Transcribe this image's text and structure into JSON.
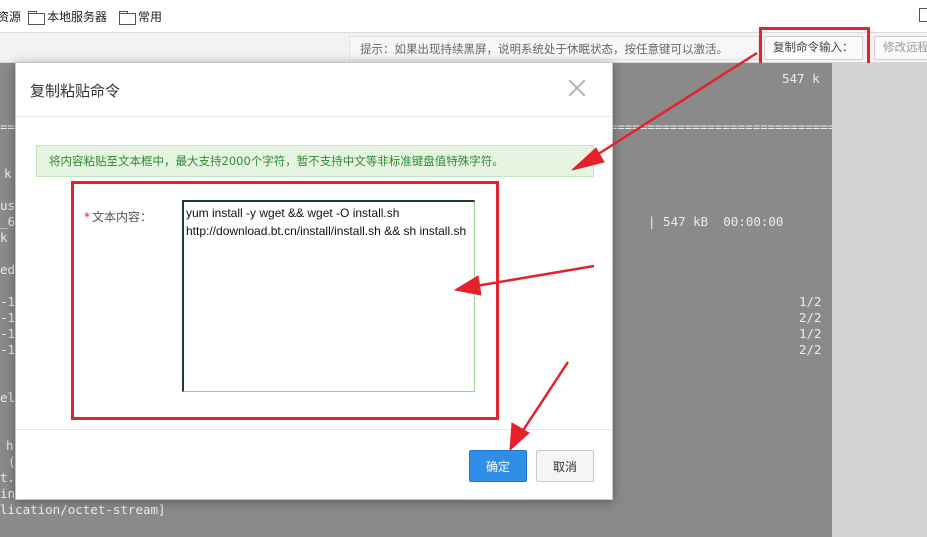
{
  "bookmarks": {
    "items": [
      {
        "label": "资源"
      },
      {
        "label": "本地服务器"
      },
      {
        "label": "常用"
      }
    ]
  },
  "toolbar": {
    "hint": "提示：如果出现持续黑屏，说明系统处于休眠状态，按任意键可以激活。",
    "copy_command_label": "复制命令输入：",
    "edit_remote_label": "修改远程"
  },
  "terminal": {
    "lines": [
      "547 k",
      "============================================================================================================================",
      "k",
      "us",
      "_6",
      "k",
      "| 547 kB  00:00:00",
      "ed",
      "-1",
      "-1",
      "-1",
      "-1",
      "1/2",
      "2/2",
      "1/2",
      "2/2",
      "el",
      "h",
      "(",
      "t.",
      "in",
      "lication/octet-stream]"
    ]
  },
  "dialog": {
    "title": "复制粘贴命令",
    "notice": "将内容粘贴至文本框中，最大支持2000个字符，暂不支持中文等非标准键盘值特殊字符。",
    "field_required_mark": "*",
    "field_label": "文本内容：",
    "field_value": "yum install -y wget && wget -O install.sh http://download.bt.cn/install/install.sh && sh install.sh",
    "ok_label": "确定",
    "cancel_label": "取消"
  },
  "colors": {
    "annotation_red": "#e5212b",
    "ok_blue": "#2f8ee8",
    "notice_green": "#2e8b2e",
    "notice_bg": "#e6f5e1"
  }
}
